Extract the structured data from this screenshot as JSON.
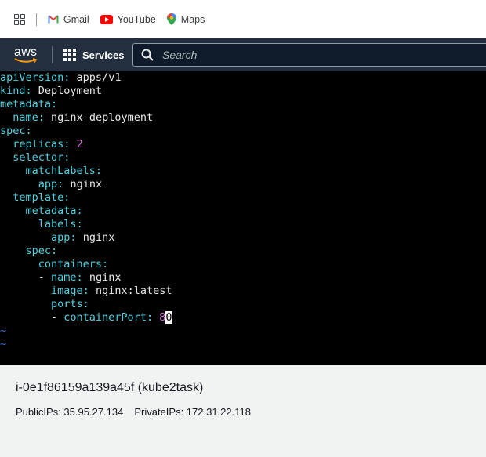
{
  "bookmarks": [
    {
      "label": "Gmail",
      "icon": "gmail-icon"
    },
    {
      "label": "YouTube",
      "icon": "youtube-icon"
    },
    {
      "label": "Maps",
      "icon": "maps-icon"
    }
  ],
  "aws": {
    "logo": "aws",
    "services_label": "Services",
    "search_placeholder": "Search"
  },
  "editor": {
    "lines": [
      {
        "key": "apiVersion",
        "indent": "",
        "value": " apps/v1"
      },
      {
        "key": "kind",
        "indent": "",
        "value": " Deployment"
      },
      {
        "key": "metadata",
        "indent": "",
        "value": ""
      },
      {
        "key": "name",
        "indent": "  ",
        "value": " nginx-deployment"
      },
      {
        "key": "spec",
        "indent": "",
        "value": ""
      },
      {
        "key": "replicas",
        "indent": "  ",
        "value": " 2",
        "numeric": true
      },
      {
        "key": "selector",
        "indent": "  ",
        "value": ""
      },
      {
        "key": "matchLabels",
        "indent": "    ",
        "value": ""
      },
      {
        "key": "app",
        "indent": "      ",
        "value": " nginx"
      },
      {
        "key": "template",
        "indent": "  ",
        "value": ""
      },
      {
        "key": "metadata",
        "indent": "    ",
        "value": ""
      },
      {
        "key": "labels",
        "indent": "      ",
        "value": ""
      },
      {
        "key": "app",
        "indent": "        ",
        "value": " nginx"
      },
      {
        "key": "spec",
        "indent": "    ",
        "value": ""
      },
      {
        "key": "containers",
        "indent": "      ",
        "value": ""
      },
      {
        "key": "name",
        "indent": "      - ",
        "value": " nginx"
      },
      {
        "key": "image",
        "indent": "        ",
        "value": " nginx:latest"
      },
      {
        "key": "ports",
        "indent": "        ",
        "value": ""
      },
      {
        "key": "containerPort",
        "indent": "        - ",
        "value": " 8",
        "numeric": true,
        "cursor": "0"
      }
    ],
    "tildes": [
      "~",
      "~"
    ]
  },
  "instance": {
    "title": "i-0e1f86159a139a45f (kube2task)",
    "public_ips": "PublicIPs: 35.95.27.134",
    "private_ips": "PrivateIPs: 172.31.22.118"
  },
  "colors": {
    "key": "#4fd1e0",
    "number": "#d070d0",
    "tilde": "#3b6fd6",
    "aws_nav": "#232f3e"
  }
}
